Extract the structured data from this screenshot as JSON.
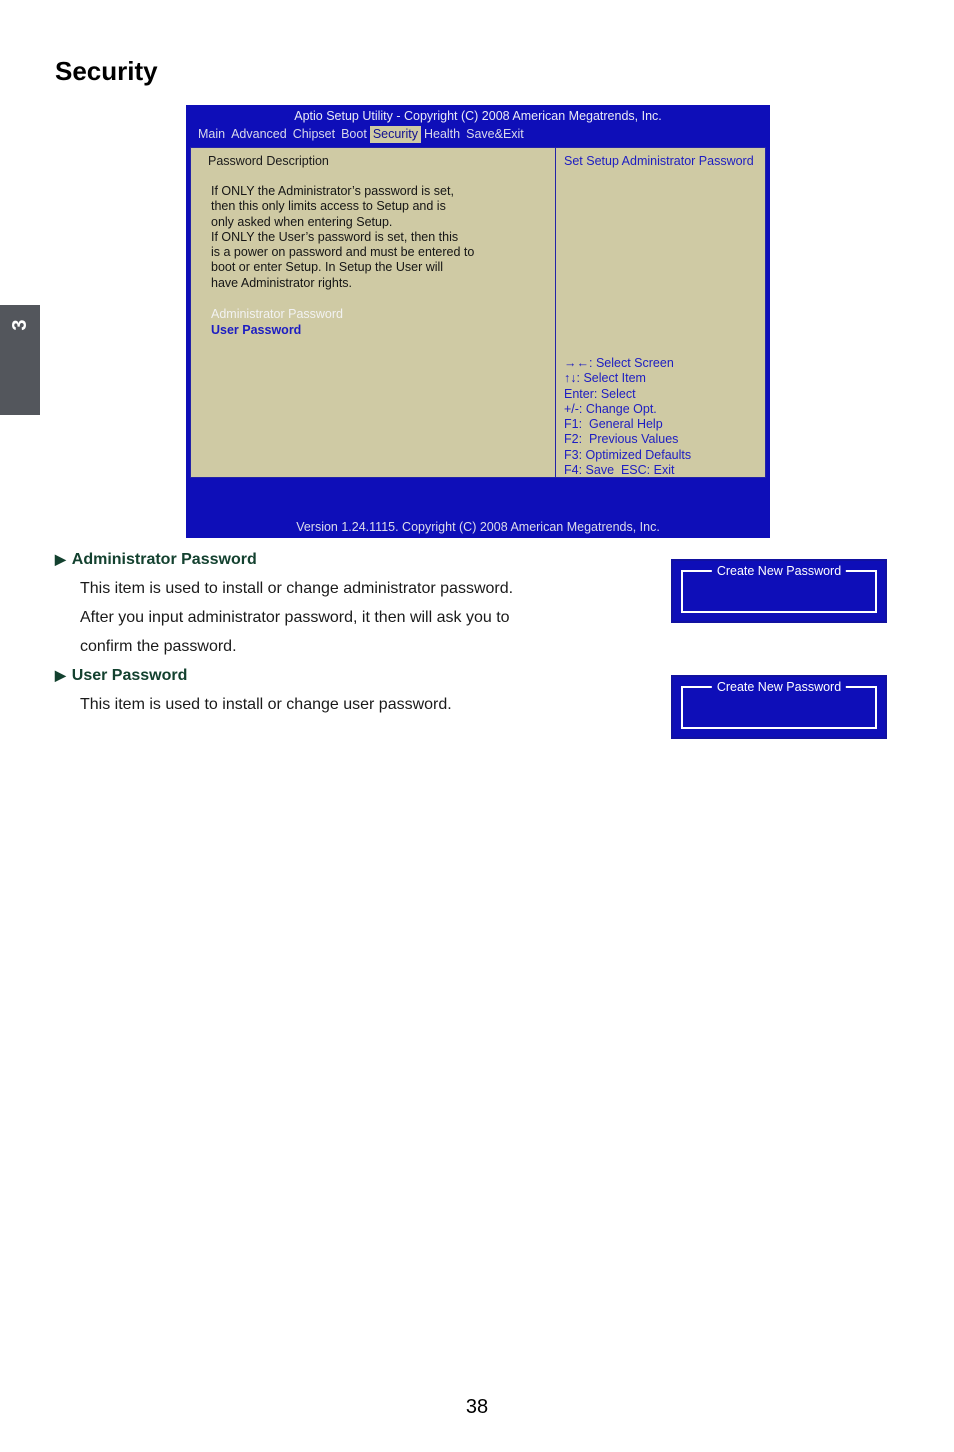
{
  "chapter": {
    "number": "3"
  },
  "page_title": "Security",
  "page_number": "38",
  "bios": {
    "title": "Aptio Setup Utility - Copyright (C) 2008 American Megatrends, Inc.",
    "menu": [
      {
        "label": "Main",
        "active": false
      },
      {
        "label": "Advanced",
        "active": false
      },
      {
        "label": "Chipset",
        "active": false
      },
      {
        "label": "Boot",
        "active": false
      },
      {
        "label": "Security",
        "active": true
      },
      {
        "label": "Health",
        "active": false
      },
      {
        "label": "Save&Exit",
        "active": false
      }
    ],
    "left_panel": {
      "heading": "Password Description",
      "description": "If ONLY the Administrator’s password is set,\nthen this only limits access to Setup and is\nonly asked when entering Setup.\nIf ONLY the User’s password is set, then this\nis a power on password and must be entered to\nboot or enter Setup. In Setup the User will\nhave Administrator rights.",
      "items": [
        {
          "label": "Administrator Password",
          "selected": true
        },
        {
          "label": "User Password",
          "selected": false
        }
      ]
    },
    "right_panel": {
      "help_title": "Set Setup Administrator Password",
      "keys": "→←: Select Screen\n↑↓: Select Item\nEnter: Select\n+/-: Change Opt.\nF1:  General Help\nF2:  Previous Values\nF3: Optimized Defaults\nF4: Save  ESC: Exit"
    },
    "version": "Version 1.24.1115. Copyright (C) 2008 American Megatrends, Inc."
  },
  "sections": [
    {
      "heading": "Administrator Password",
      "bullet": "▶",
      "paragraphs": [
        "This item is used to install or change administrator password.",
        "After you input administrator password, it then will ask you to",
        "confirm the password."
      ]
    },
    {
      "heading": "User Password",
      "bullet": "▶",
      "paragraphs": [
        "This item is used to install or change user password."
      ]
    }
  ],
  "dialogs": [
    {
      "title": "Create New Password"
    },
    {
      "title": "Create New Password"
    }
  ],
  "colors": {
    "bios_blue": "#0e0eb8",
    "bios_panel": "#cfcaa4",
    "heading_green": "#13412f",
    "chapter_tab": "#53565c"
  }
}
